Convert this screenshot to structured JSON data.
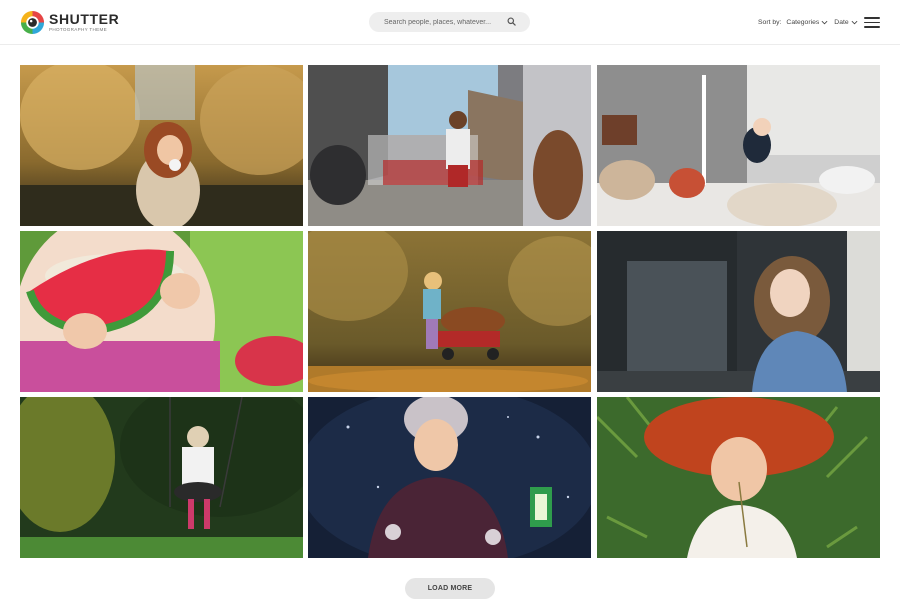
{
  "brand": {
    "name": "SHUTTER",
    "tagline": "PHOTOGRAPHY THEME",
    "colors": [
      "#e64545",
      "#f5b31b",
      "#2fa7d9",
      "#48b04a"
    ]
  },
  "search": {
    "placeholder": "Search people, places, whatever...",
    "value": "",
    "icon": "search-icon"
  },
  "sort": {
    "label": "Sort by:",
    "options": [
      {
        "label": "Categories",
        "icon": "chevron-down-icon"
      },
      {
        "label": "Date",
        "icon": "chevron-down-icon"
      }
    ]
  },
  "menu": {
    "icon": "hamburger-menu-icon"
  },
  "gallery": {
    "columns": 3,
    "rows": 3,
    "photos": [
      {
        "subject": "girl-in-autumn-park"
      },
      {
        "subject": "schoolchildren-running-in-street"
      },
      {
        "subject": "child-with-camera-and-plush-toys"
      },
      {
        "subject": "child-eating-watermelon"
      },
      {
        "subject": "toddler-pulling-wagon-of-leaves"
      },
      {
        "subject": "girl-in-denim-jacket"
      },
      {
        "subject": "girl-on-swing-in-forest"
      },
      {
        "subject": "child-in-snow-with-lantern"
      },
      {
        "subject": "red-haired-girl-lying-in-grass"
      }
    ]
  },
  "load_more": {
    "label": "LOAD MORE"
  }
}
